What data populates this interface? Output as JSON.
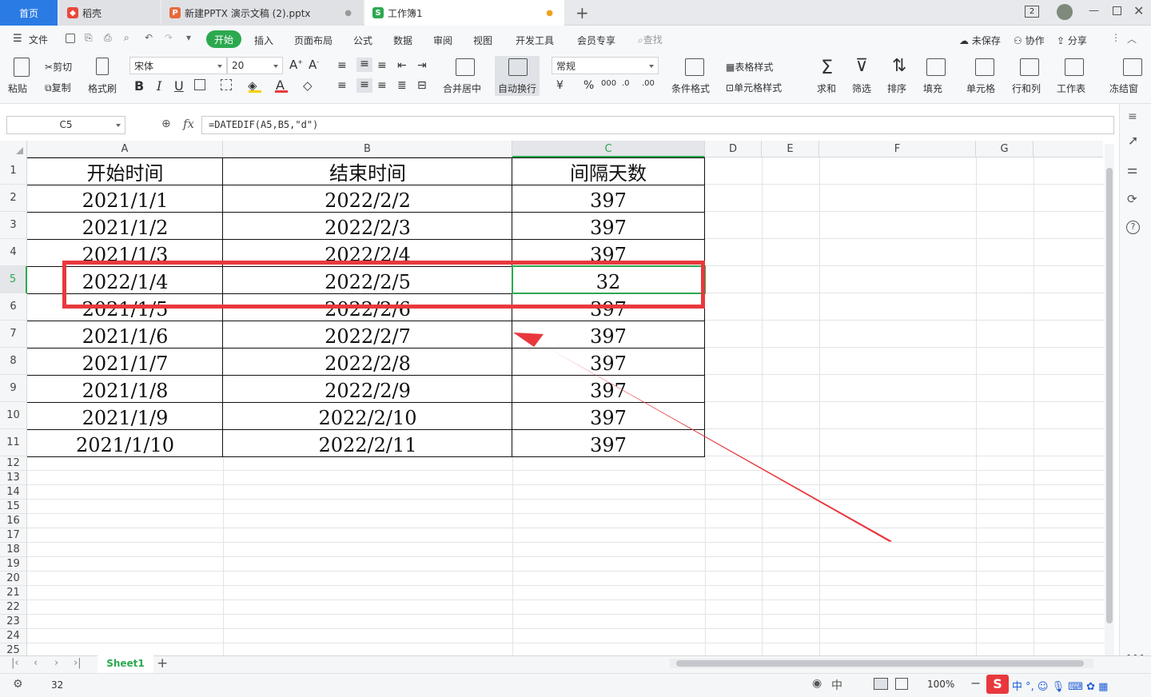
{
  "tabs": [
    {
      "label": "首页"
    },
    {
      "label": "稻壳"
    },
    {
      "label": "新建PPTX 演示文稿 (2).pptx"
    },
    {
      "label": "工作簿1"
    }
  ],
  "window": {
    "badge": "2"
  },
  "menu": {
    "file": "文件",
    "items": [
      "开始",
      "插入",
      "页面布局",
      "公式",
      "数据",
      "审阅",
      "视图",
      "开发工具",
      "会员专享"
    ],
    "search": "查找",
    "unsaved": "未保存",
    "collab": "协作",
    "share": "分享"
  },
  "ribbon": {
    "paste": "粘贴",
    "cut": "剪切",
    "copy": "复制",
    "format_painter": "格式刷",
    "font_name": "宋体",
    "font_size": "20",
    "merge_center": "合并居中",
    "wrap_text": "自动换行",
    "number_format": "常规",
    "cond_format": "条件格式",
    "table_style": "表格样式",
    "cell_style": "单元格样式",
    "sum": "求和",
    "filter": "筛选",
    "sort": "排序",
    "fill": "填充",
    "cell": "单元格",
    "row_col": "行和列",
    "worksheet": "工作表",
    "freeze": "冻结窗"
  },
  "formula_bar": {
    "name_box": "C5",
    "fx_label": "fx",
    "formula": "=DATEDIF(A5,B5,\"d\")"
  },
  "columns": [
    "A",
    "B",
    "C",
    "D",
    "E",
    "F",
    "G"
  ],
  "rows": [
    "1",
    "2",
    "3",
    "4",
    "5",
    "6",
    "7",
    "8",
    "9",
    "10",
    "11",
    "12",
    "13",
    "14",
    "15",
    "16",
    "17",
    "18",
    "19",
    "20",
    "21",
    "22",
    "23",
    "24",
    "25"
  ],
  "table": {
    "headers": [
      "开始时间",
      "结束时间",
      "间隔天数"
    ],
    "data": [
      [
        "2021/1/1",
        "2022/2/2",
        "397"
      ],
      [
        "2021/1/2",
        "2022/2/3",
        "397"
      ],
      [
        "2021/1/3",
        "2022/2/4",
        "397"
      ],
      [
        "2022/1/4",
        "2022/2/5",
        "32"
      ],
      [
        "2021/1/5",
        "2022/2/6",
        "397"
      ],
      [
        "2021/1/6",
        "2022/2/7",
        "397"
      ],
      [
        "2021/1/7",
        "2022/2/8",
        "397"
      ],
      [
        "2021/1/8",
        "2022/2/9",
        "397"
      ],
      [
        "2021/1/9",
        "2022/2/10",
        "397"
      ],
      [
        "2021/1/10",
        "2022/2/11",
        "397"
      ]
    ]
  },
  "sheets": [
    "Sheet1"
  ],
  "status": {
    "value": "32",
    "zoom": "100%"
  },
  "colors": {
    "accent_green": "#2ca94f",
    "tab_blue": "#2b7be5",
    "annotation_red": "#e8383d"
  }
}
